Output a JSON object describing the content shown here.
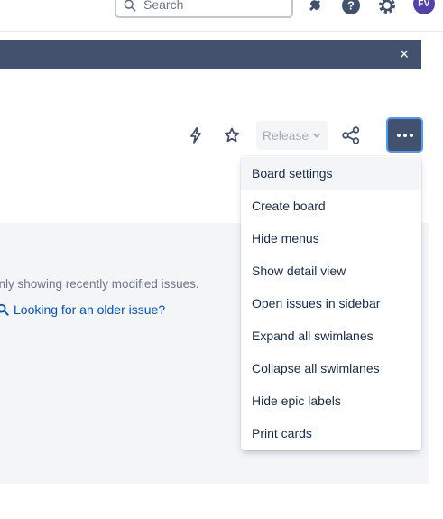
{
  "topnav": {
    "search_placeholder": "Search",
    "notification_icon": "notification-bell-icon",
    "help_icon": "help-icon",
    "settings_icon": "gear-icon",
    "avatar_initials": "FV",
    "avatar_color": "#5243aa"
  },
  "banner": {
    "close_label": "×",
    "color": "#42526e"
  },
  "toolbar": {
    "automation_icon": "lightning-icon",
    "star_icon": "star-icon",
    "release_label": "Release",
    "share_icon": "share-icon",
    "more_icon": "more-horizontal-icon"
  },
  "board": {
    "info_text": "Only showing recently modified issues.",
    "older_issue_link": "Looking for an older issue?"
  },
  "menu": {
    "items": [
      {
        "label": "Board settings"
      },
      {
        "label": "Create board"
      },
      {
        "label": "Hide menus"
      },
      {
        "label": "Show detail view"
      },
      {
        "label": "Open issues in sidebar"
      },
      {
        "label": "Expand all swimlanes"
      },
      {
        "label": "Collapse all swimlanes"
      },
      {
        "label": "Hide epic labels"
      },
      {
        "label": "Print cards"
      }
    ]
  },
  "colors": {
    "accent": "#0052cc",
    "focus": "#4c9aff",
    "text": "#172b4d",
    "subtle_text": "#6b778c"
  }
}
